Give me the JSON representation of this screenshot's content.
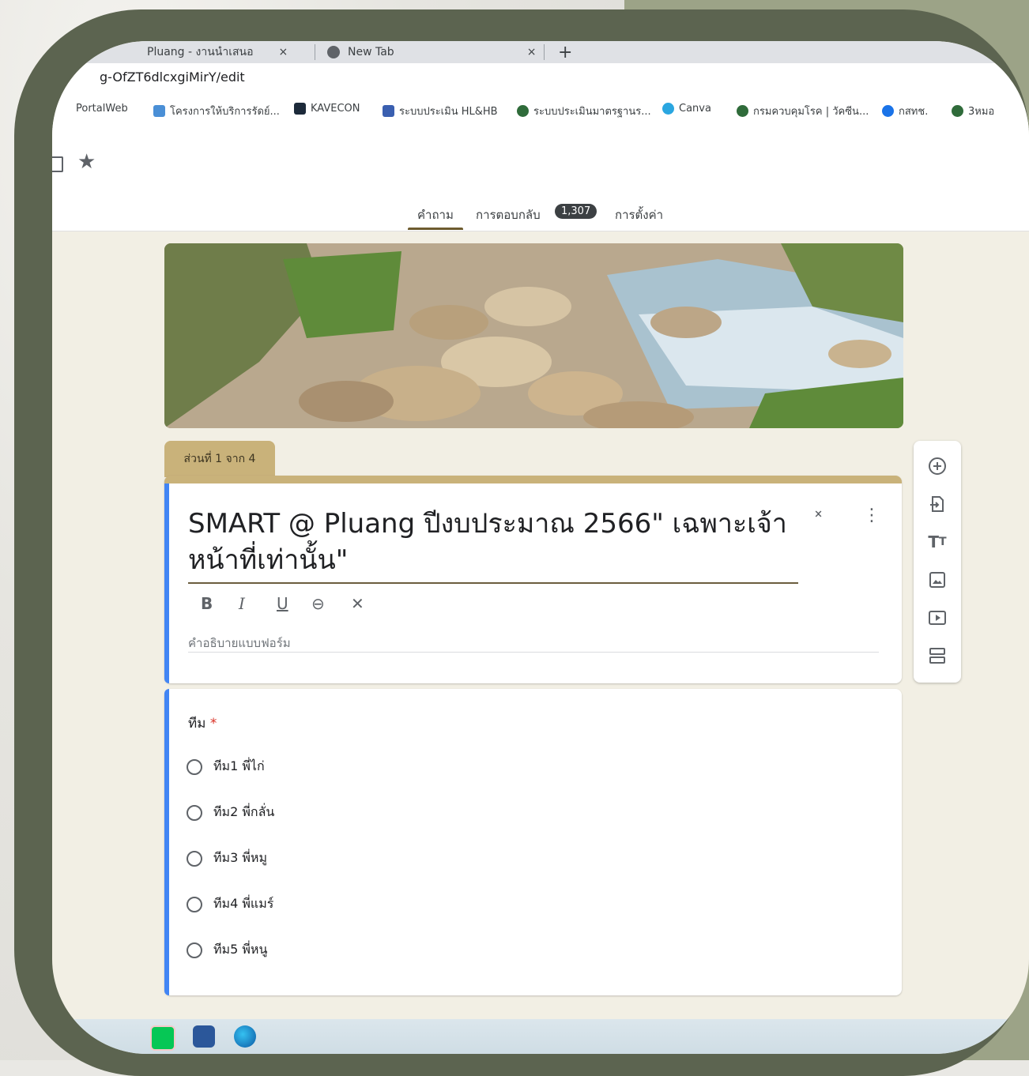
{
  "browser": {
    "tabs": [
      {
        "label": "Pluang - งานนำเสนอ",
        "close": "×"
      },
      {
        "label": "New Tab",
        "close": "×"
      }
    ],
    "new_tab": "+",
    "url": "g-OfZT6dlcxgiMirY/edit",
    "bookmarks": [
      {
        "label": "PortalWeb",
        "color": "#ffffff"
      },
      {
        "label": "โครงการให้บริการรัดย์...",
        "color": "#4a8fd6"
      },
      {
        "label": "KAVECON",
        "color": "#1c2a3a"
      },
      {
        "label": "ระบบประเมิน HL&HB",
        "color": "#3a5fb0"
      },
      {
        "label": "ระบบประเมินมาตรฐานร...",
        "color": "#2f6b3a"
      },
      {
        "label": "Canva",
        "color": "#2aa6e0"
      },
      {
        "label": "กรมควบคุมโรค | วัคซีน...",
        "color": "#2f6b3a"
      },
      {
        "label": "กสทช.",
        "color": "#1a73e8"
      },
      {
        "label": "3หมอ",
        "color": "#2f6b3a"
      }
    ]
  },
  "forms": {
    "nav": {
      "questions": "คำถาม",
      "responses": "การตอบกลับ",
      "responses_count": "1,307",
      "settings": "การตั้งค่า"
    },
    "section_label": "ส่วนที่ 1 จาก 4",
    "title": "SMART @ Pluang ปีงบประมาณ 2566\" เฉพาะเจ้าหน้าที่เท่านั้น\"",
    "format": {
      "bold": "B",
      "italic": "I",
      "underline": "U",
      "link": "⊖",
      "clear": "✕"
    },
    "description_placeholder": "คำอธิบายแบบฟอร์ม",
    "question": {
      "label": "ทีม",
      "required_mark": "*",
      "options": [
        "ทีม1 พี่ไก่",
        "ทีม2 พี่กลั่น",
        "ทีม3 พี่หมู",
        "ทีม4 พี่แมร์",
        "ทีม5 พี่หนู"
      ]
    }
  },
  "colors": {
    "accent": "#c9b27a",
    "blue": "#4285f4",
    "frame": "#5c6450"
  }
}
